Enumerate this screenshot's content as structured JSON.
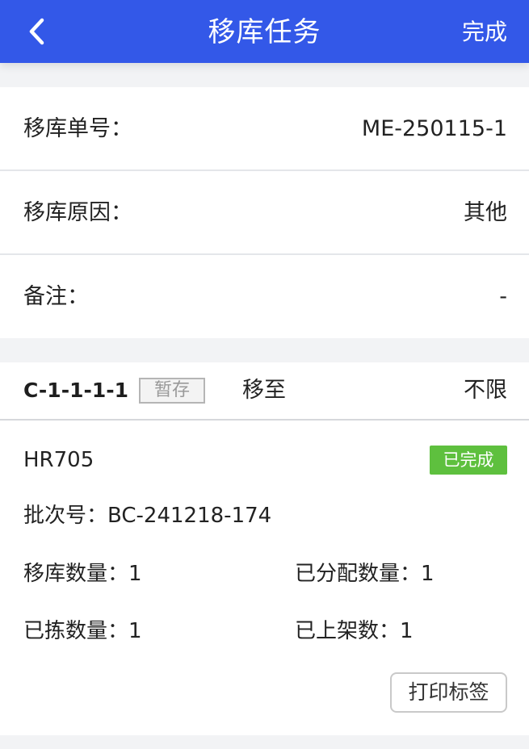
{
  "header": {
    "title": "移库任务",
    "done_label": "完成",
    "back_icon": "chevron-left-icon"
  },
  "info": {
    "rows": [
      {
        "label": "移库单号：",
        "value": "ME-250115-1"
      },
      {
        "label": "移库原因：",
        "value": "其他"
      },
      {
        "label": "备注：",
        "value": "-"
      }
    ]
  },
  "task": {
    "location": "C-1-1-1-1",
    "location_tag": "暂存",
    "move_to_label": "移至",
    "destination": "不限",
    "item_code": "HR705",
    "status": "已完成",
    "batch_label": "批次号：",
    "batch_value": "BC-241218-174",
    "move_qty_label": "移库数量：",
    "move_qty_value": "1",
    "allocated_qty_label": "已分配数量：",
    "allocated_qty_value": "1",
    "picked_qty_label": "已拣数量：",
    "picked_qty_value": "1",
    "shelved_qty_label": "已上架数：",
    "shelved_qty_value": "1",
    "print_label": "打印标签"
  },
  "colors": {
    "header_bg": "#3358e8",
    "status_bg": "#5ec03e",
    "page_bg": "#f2f3f5"
  }
}
